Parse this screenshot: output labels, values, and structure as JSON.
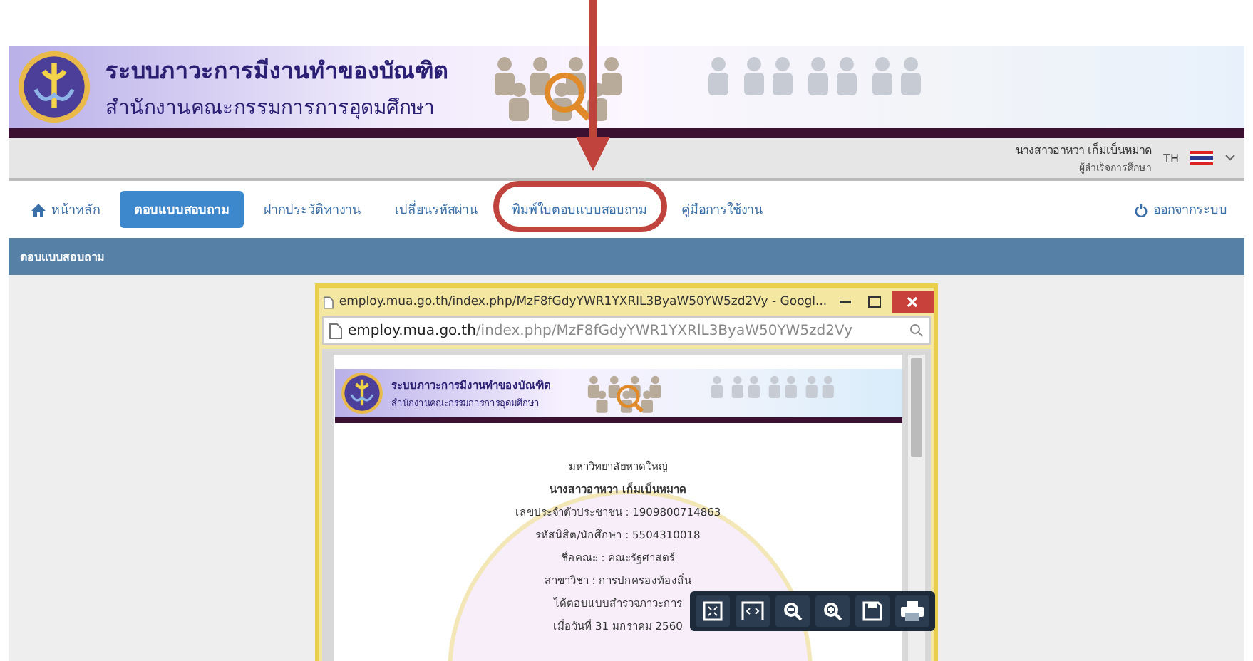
{
  "header": {
    "title": "ระบบภาวะการมีงานทำของบัณฑิต",
    "subtitle": "สำนักงานคณะกรรมการการอุดมศึกษา"
  },
  "user": {
    "name": "นางสาวอาหวา เก็มเบ็นหมาด",
    "role": "ผู้สำเร็จการศึกษา",
    "language": "TH"
  },
  "nav": {
    "tabs": [
      {
        "label": "หน้าหลัก",
        "selected": false,
        "kind": "home"
      },
      {
        "label": "ตอบแบบสอบถาม",
        "selected": true,
        "kind": "plain"
      },
      {
        "label": "ฝากประวัติหางาน",
        "selected": false,
        "kind": "plain"
      },
      {
        "label": "เปลี่ยนรหัสผ่าน",
        "selected": false,
        "kind": "plain"
      },
      {
        "label": "พิมพ์ใบตอบแบบสอบถาม",
        "selected": false,
        "kind": "plain",
        "highlighted": true
      },
      {
        "label": "คู่มือการใช้งาน",
        "selected": false,
        "kind": "plain"
      }
    ],
    "logout": "ออกจากระบบ"
  },
  "section": {
    "title": "ตอบแบบสอบถาม"
  },
  "popup": {
    "title": "employ.mua.go.th/index.php/MzF8fGdyYWR1YXRlL3ByaW50YW5zd2Vy - Googl...",
    "address_host": "employ.mua.go.th",
    "address_path": "/index.php/MzF8fGdyYWR1YXRlL3ByaW50YW5zd2Vy",
    "document": {
      "header_title": "ระบบภาวะการมีงานทำของบัณฑิต",
      "header_subtitle": "สำนักงานคณะกรรมการการอุดมศึกษา",
      "lines": [
        {
          "text": "มหาวิทยาลัยหาดใหญ่",
          "bold": false
        },
        {
          "text": "นางสาวอาหวา เก็มเบ็นหมาด",
          "bold": true
        },
        {
          "text": "เลขประจำตัวประชาชน : 1909800714863",
          "bold": false
        },
        {
          "text": "รหัสนิสิต/นักศึกษา : 5504310018",
          "bold": false
        },
        {
          "text": "ชื่อคณะ : คณะรัฐศาสตร์",
          "bold": false
        },
        {
          "text": "สาขาวิชา : การปกครองท้องถิ่น",
          "bold": false
        },
        {
          "text": "ได้ตอบแบบสำรวจภาวะการ",
          "bold": false
        },
        {
          "text": "เมื่อวันที่ 31 มกราคม 2560",
          "bold": false
        }
      ]
    },
    "viewer_tools": [
      {
        "kind": "fit"
      },
      {
        "kind": "width"
      },
      {
        "kind": "zoom-out"
      },
      {
        "kind": "zoom-in"
      },
      {
        "kind": "save"
      },
      {
        "kind": "print"
      }
    ]
  }
}
